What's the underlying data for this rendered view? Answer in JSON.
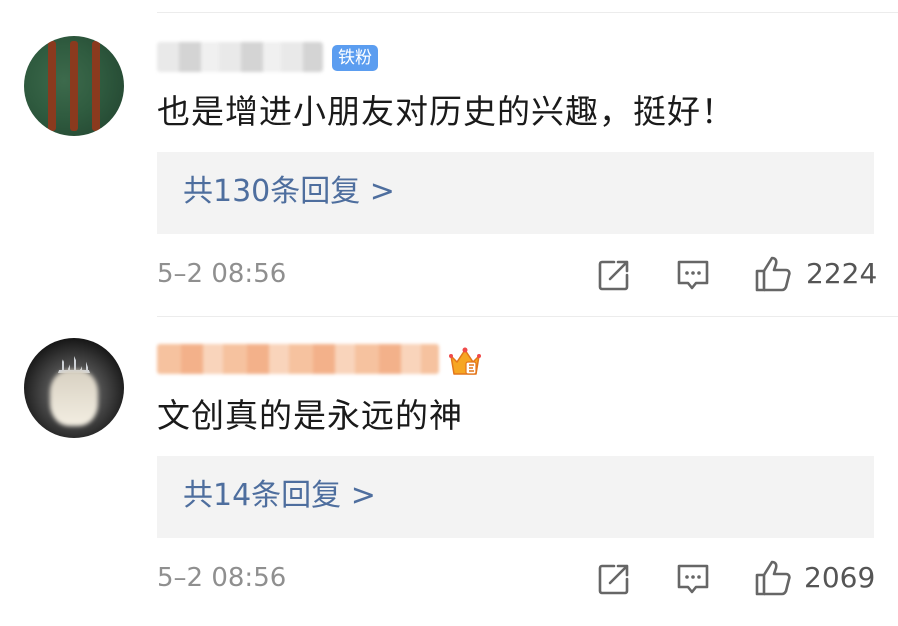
{
  "comments": [
    {
      "badge": "铁粉",
      "text": "也是增进小朋友对历史的兴趣，挺好！",
      "reply_label": "共130条回复 >",
      "time": "5–2 08:56",
      "likes": "2224",
      "avatar_icon": "avatar-photo",
      "name_icon": "blurred-username"
    },
    {
      "badge_icon": "crown-fan-badge-icon",
      "text": "文创真的是永远的神",
      "reply_label": "共14条回复 >",
      "time": "5–2 08:56",
      "likes": "2069",
      "avatar_icon": "avatar-photo",
      "name_icon": "blurred-username"
    }
  ],
  "colors": {
    "reply_link": "#4e6e9e",
    "badge_blue": "#5b9df0",
    "meta_gray": "#8f8f8f"
  }
}
